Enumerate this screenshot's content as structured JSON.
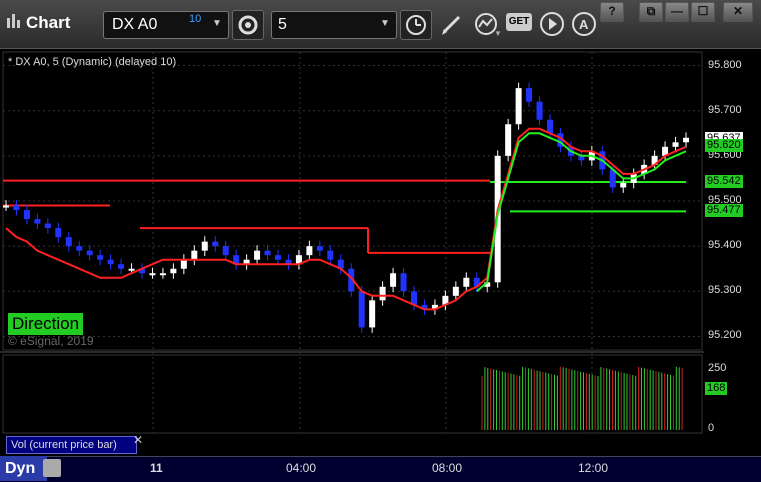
{
  "window": {
    "title": "Chart",
    "symbol": "DX A0",
    "symbol_superscript": "10",
    "interval": "5",
    "buttons": [
      "?",
      "⧉",
      "—",
      "☐",
      "✕"
    ]
  },
  "toolbar": {
    "icons": [
      "gear-icon",
      "clock-icon",
      "pencil-icon",
      "study-icon",
      "get-icon",
      "play-icon",
      "alert-icon"
    ],
    "get_label": "GET"
  },
  "price_panel": {
    "header": "* DX A0, 5 (Dynamic) (delayed 10)",
    "direction_label": "Direction",
    "copyright": "© eSignal, 2019",
    "yticks": [
      "95.800",
      "95.700",
      "95.600",
      "95.500",
      "95.400",
      "95.300",
      "95.200"
    ],
    "tags": [
      {
        "text": "95.637",
        "color": "#ffffff",
        "bg": "#ffffff",
        "fg": "#000000"
      },
      {
        "text": "95.620",
        "color": "#22cc22",
        "bg": "#22cc22",
        "fg": "#000000"
      },
      {
        "text": "95.542",
        "color": "#22cc22",
        "bg": "#22cc22",
        "fg": "#000000"
      },
      {
        "text": "95.477",
        "color": "#22cc22",
        "bg": "#22cc22",
        "fg": "#000000"
      }
    ]
  },
  "volume_panel": {
    "label": "Vol (current price bar)",
    "close": "✕",
    "yticks": [
      "250",
      "0"
    ],
    "tag": "168"
  },
  "bottom": {
    "dyn": "Dyn",
    "xticks": [
      "11",
      "04:00",
      "08:00",
      "12:00"
    ]
  },
  "colors": {
    "up_bar": "#ffffff",
    "down_bar": "#2233ff",
    "resistance": "#ff2020",
    "support": "#22ee22",
    "volume_up": "#33cc33",
    "volume_down": "#cc2222"
  },
  "chart_data": {
    "type": "candlestick",
    "title": "* DX A0, 5 (Dynamic) (delayed 10)",
    "ylim": [
      95.17,
      95.83
    ],
    "x_labels": [
      "11",
      "04:00",
      "08:00",
      "12:00"
    ],
    "price_series": [
      95.49,
      95.48,
      95.46,
      95.45,
      95.44,
      95.42,
      95.4,
      95.39,
      95.38,
      95.37,
      95.36,
      95.35,
      95.35,
      95.34,
      95.34,
      95.34,
      95.35,
      95.37,
      95.39,
      95.41,
      95.4,
      95.38,
      95.36,
      95.37,
      95.39,
      95.38,
      95.37,
      95.36,
      95.38,
      95.4,
      95.39,
      95.37,
      95.35,
      95.3,
      95.22,
      95.28,
      95.31,
      95.34,
      95.3,
      95.27,
      95.26,
      95.27,
      95.29,
      95.31,
      95.33,
      95.31,
      95.32,
      95.6,
      95.67,
      95.75,
      95.72,
      95.68,
      95.65,
      95.62,
      95.6,
      95.59,
      95.61,
      95.57,
      95.53,
      95.54,
      95.56,
      95.58,
      95.6,
      95.62,
      95.63,
      95.64
    ],
    "support_line": [
      95.44,
      95.42,
      95.41,
      95.39,
      95.38,
      95.37,
      95.36,
      95.35,
      95.34,
      95.33,
      95.33,
      95.33,
      95.34,
      95.35,
      95.36,
      95.37,
      95.37,
      95.37,
      95.37,
      95.37,
      95.37,
      95.37,
      95.36,
      95.36,
      95.36,
      95.36,
      95.36,
      95.36,
      95.36,
      95.37,
      95.37,
      95.36,
      95.35,
      95.33,
      95.3,
      95.29,
      95.29,
      95.29,
      95.28,
      95.27,
      95.26,
      95.26,
      95.27,
      95.28,
      95.3,
      95.31,
      95.33,
      95.48,
      95.56,
      95.64,
      95.66,
      95.66,
      95.65,
      95.64,
      95.62,
      95.61,
      95.61,
      95.6,
      95.58,
      95.56,
      95.56,
      95.57,
      95.58,
      95.6,
      95.61,
      95.62
    ],
    "resistance_levels": [
      95.542,
      95.477,
      95.44,
      95.37
    ],
    "volume": [
      250,
      168
    ],
    "volume_ylim": [
      0,
      300
    ],
    "last_price": 95.637
  }
}
